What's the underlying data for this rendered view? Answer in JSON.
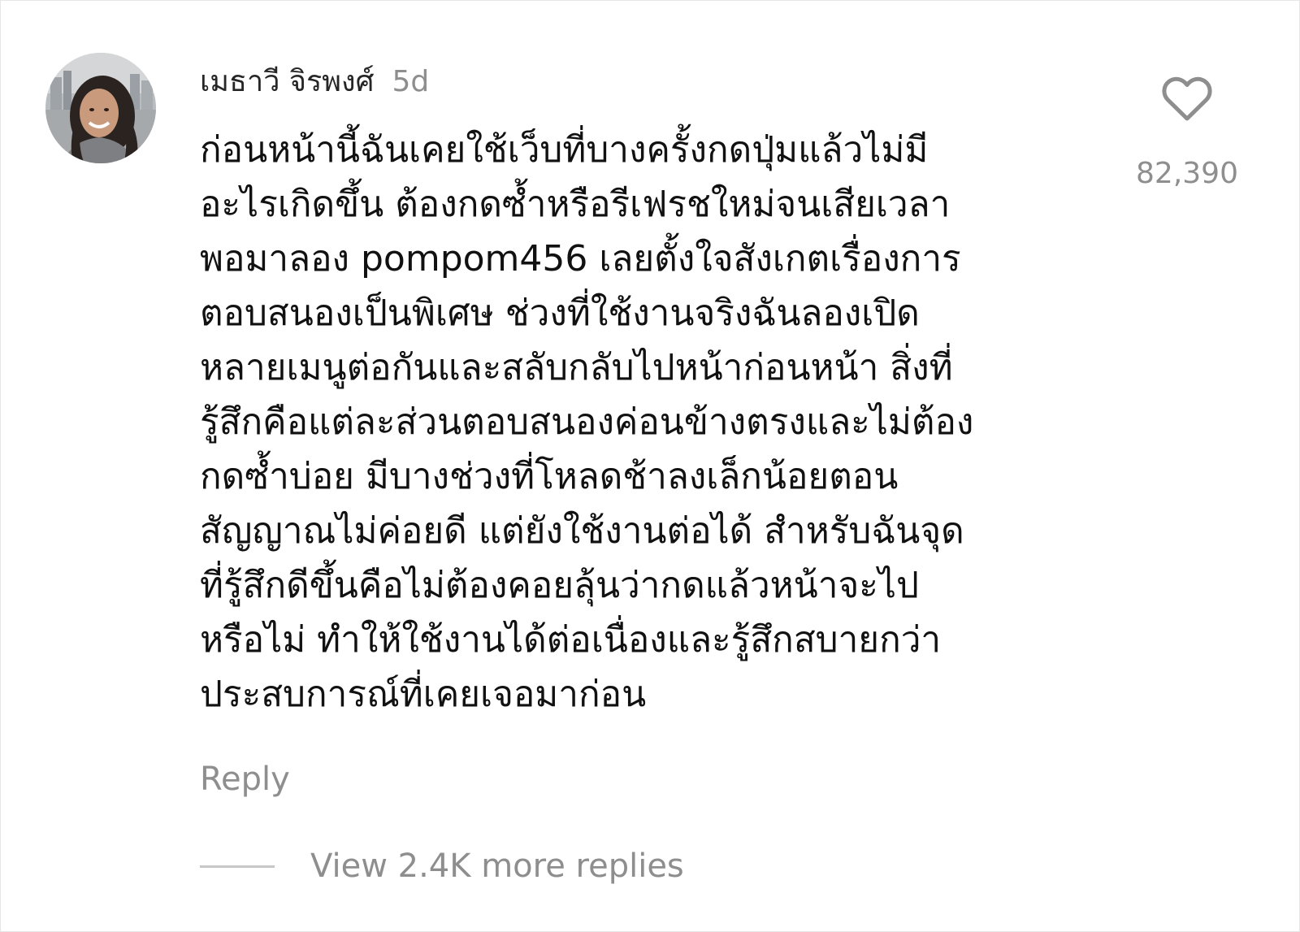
{
  "comment": {
    "username": "เมธาวี จิรพงศ์",
    "time": "5d",
    "avatar": "profile-photo-woman",
    "body_lines": [
      "ก่อนหน้านี้ฉันเคยใช้เว็บที่บางครั้งกดปุ่มแล้วไม่มี",
      "อะไรเกิดขึ้น ต้องกดซ้ำหรือรีเฟรชใหม่จนเสียเวลา",
      "พอมาลอง pompom456 เลยตั้งใจสังเกตเรื่องการ",
      "ตอบสนองเป็นพิเศษ ช่วงที่ใช้งานจริงฉันลองเปิด",
      "หลายเมนูต่อกันและสลับกลับไปหน้าก่อนหน้า สิ่งที่",
      "รู้สึกคือแต่ละส่วนตอบสนองค่อนข้างตรงและไม่ต้อง",
      "กดซ้ำบ่อย มีบางช่วงที่โหลดช้าลงเล็กน้อยตอน",
      "สัญญาณไม่ค่อยดี แต่ยังใช้งานต่อได้ สำหรับฉันจุด",
      "ที่รู้สึกดีขึ้นคือไม่ต้องคอยลุ้นว่ากดแล้วหน้าจะไป",
      "หรือไม่ ทำให้ใช้งานได้ต่อเนื่องและรู้สึกสบายกว่า",
      "ประสบการณ์ที่เคยเจอมาก่อน"
    ],
    "like_icon": "heart-outline-icon",
    "like_count": "82,390",
    "reply_label": "Reply",
    "view_replies_label": "View 2.4K more replies"
  },
  "colors": {
    "text_primary": "#111111",
    "text_secondary": "#8e8e8e",
    "divider": "#c7c7c7",
    "background": "#ffffff"
  }
}
